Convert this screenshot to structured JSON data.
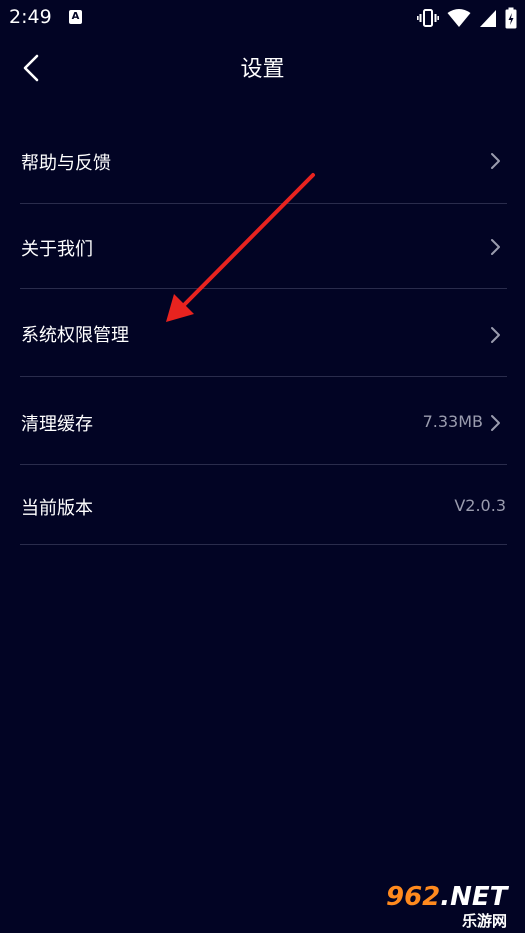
{
  "status_bar": {
    "time": "2:49",
    "notification_icon": "A"
  },
  "header": {
    "title": "设置"
  },
  "settings": {
    "items": [
      {
        "label": "帮助与反馈",
        "value": ""
      },
      {
        "label": "关于我们",
        "value": ""
      },
      {
        "label": "系统权限管理",
        "value": ""
      },
      {
        "label": "清理缓存",
        "value": "7.33MB"
      },
      {
        "label": "当前版本",
        "value": "V2.0.3"
      }
    ]
  },
  "watermark": {
    "digits": "962",
    "domain": ".NET",
    "site_name": "乐游网"
  },
  "colors": {
    "background": "#020424",
    "divider": "#2a2c4c",
    "secondary_text": "#9a9cae",
    "annotation_arrow": "#e8231f",
    "watermark_accent": "#ff8a1e"
  }
}
